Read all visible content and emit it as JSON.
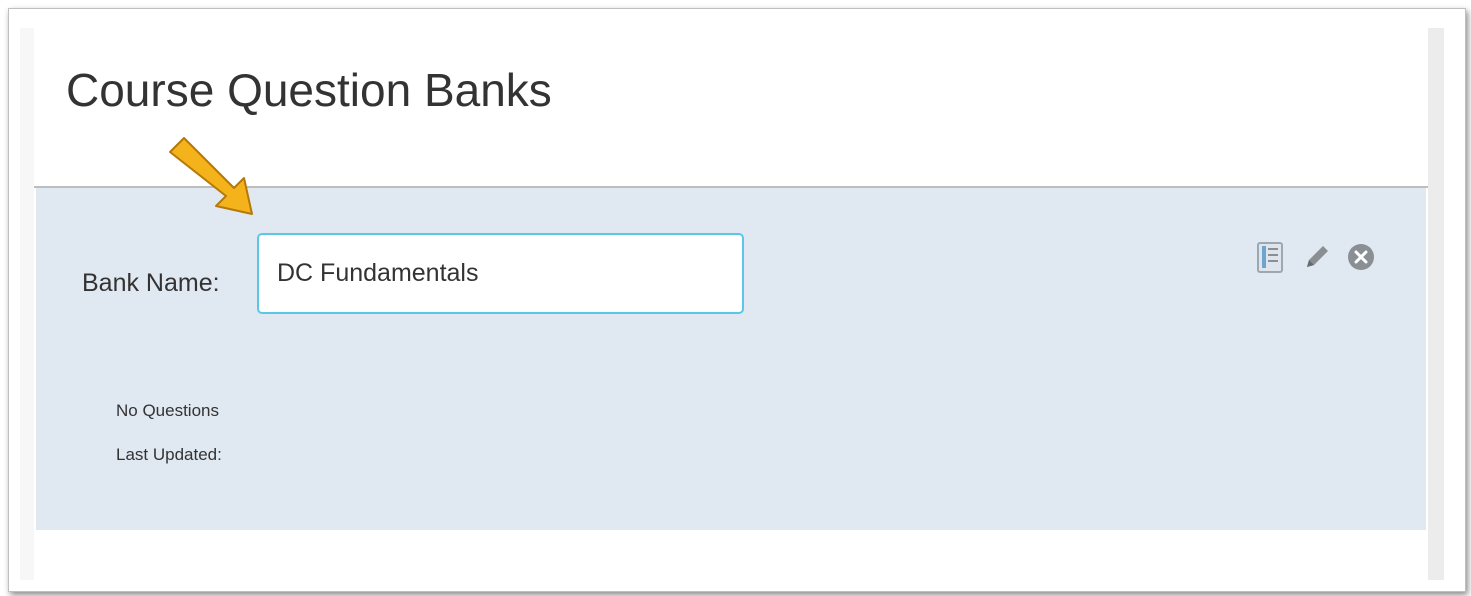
{
  "page": {
    "title": "Course Question Banks"
  },
  "bank": {
    "name_label": "Bank Name:",
    "name_value": "DC Fundamentals",
    "question_count_text": "No Questions",
    "last_updated_label": "Last Updated:"
  },
  "icons": {
    "bank": "question-bank-icon",
    "edit": "pencil-icon",
    "delete": "close-circle-icon"
  },
  "colors": {
    "panel_background": "#e0e8f1",
    "input_border": "#5bc7e6",
    "arrow": "#f4b21b",
    "icon_gray": "#8a8f94"
  }
}
